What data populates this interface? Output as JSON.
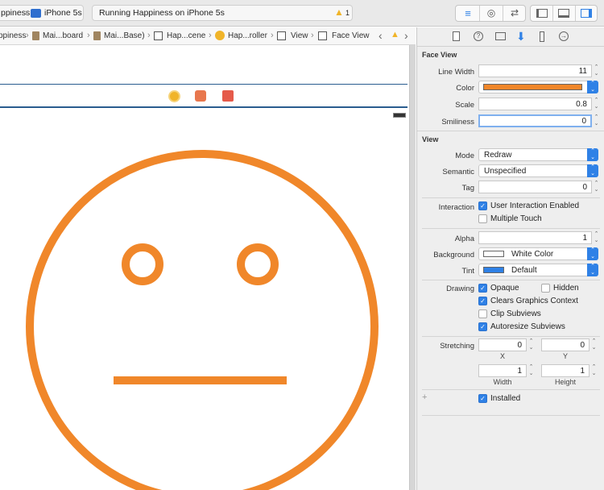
{
  "toolbar": {
    "scheme_label": "ppiness",
    "device_label": "iPhone 5s",
    "activity_text": "Running Happiness on iPhone 5s",
    "warning_count": "1"
  },
  "breadcrumbs": [
    "ppiness",
    "Mai...board",
    "Mai...Base)",
    "Hap...cene",
    "Hap...roller",
    "View",
    "Face View"
  ],
  "inspector": {
    "face_view": {
      "title": "Face View",
      "line_width_label": "Line Width",
      "line_width_value": "11",
      "color_label": "Color",
      "color_value": "#f0872a",
      "scale_label": "Scale",
      "scale_value": "0.8",
      "smiliness_label": "Smiliness",
      "smiliness_value": "0"
    },
    "view": {
      "title": "View",
      "mode_label": "Mode",
      "mode_value": "Redraw",
      "semantic_label": "Semantic",
      "semantic_value": "Unspecified",
      "tag_label": "Tag",
      "tag_value": "0",
      "interaction_label": "Interaction",
      "user_interaction_label": "User Interaction Enabled",
      "user_interaction_checked": true,
      "multiple_touch_label": "Multiple Touch",
      "multiple_touch_checked": false,
      "alpha_label": "Alpha",
      "alpha_value": "1",
      "background_label": "Background",
      "background_value": "White Color",
      "background_swatch": "#ffffff",
      "tint_label": "Tint",
      "tint_value": "Default",
      "tint_swatch": "#2f81e6",
      "drawing_label": "Drawing",
      "opaque_label": "Opaque",
      "opaque_checked": true,
      "hidden_label": "Hidden",
      "hidden_checked": false,
      "clears_label": "Clears Graphics Context",
      "clears_checked": true,
      "clip_label": "Clip Subviews",
      "clip_checked": false,
      "autoresize_label": "Autoresize Subviews",
      "autoresize_checked": true,
      "stretching_label": "Stretching",
      "stretch_x_value": "0",
      "stretch_y_value": "0",
      "stretch_w_value": "1",
      "stretch_h_value": "1",
      "x_label": "X",
      "y_label": "Y",
      "width_label": "Width",
      "height_label": "Height",
      "plus_label": "+",
      "installed_label": "Installed",
      "installed_checked": true
    }
  },
  "colors": {
    "face_stroke": "#f0872a",
    "accent": "#2f81e6",
    "warning": "#f0b429"
  }
}
